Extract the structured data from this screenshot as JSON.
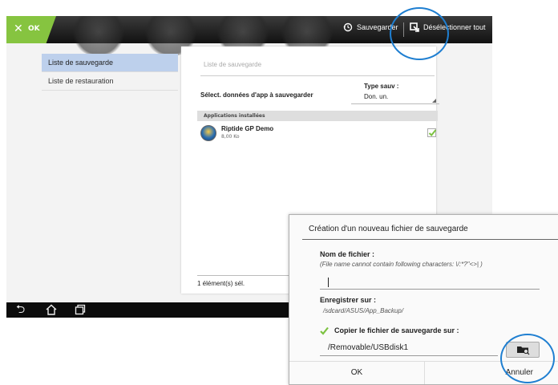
{
  "topbar": {
    "ok_label": "OK",
    "save_label": "Sauvegarder",
    "deselect_label": "Désélectionner tout"
  },
  "sidebar": {
    "items": [
      {
        "label": "Liste de sauvegarde",
        "active": true
      },
      {
        "label": "Liste de restauration",
        "active": false
      }
    ]
  },
  "panel": {
    "title": "Liste de sauvegarde",
    "select_label": "Sélect. données d'app à sauvegarder",
    "type_label": "Type sauv :",
    "type_value": "Don. un.",
    "installed_header": "Applications installées",
    "apps": [
      {
        "name": "Riptide GP Demo",
        "size": "8,00 Ko",
        "checked": true
      }
    ],
    "selected_count": "1 élément(s) sél."
  },
  "dialog": {
    "title": "Création d'un nouveau fichier de sauvegarde",
    "filename_label": "Nom de fichier :",
    "filename_hint": "(File name cannot contain following characters: \\/:*?\"<>| )",
    "filename_value": "",
    "save_to_label": "Enregistrer sur :",
    "save_to_path": "/sdcard/ASUS/App_Backup/",
    "copy_label": "Copier le fichier de sauvegarde sur :",
    "copy_checked": true,
    "copy_path": "/Removable/USBdisk1",
    "ok_label": "OK",
    "cancel_label": "Annuler"
  },
  "colors": {
    "accent": "#86c440",
    "selected_row": "#bdd0ec",
    "highlight_circle": "#1f7fd1"
  }
}
